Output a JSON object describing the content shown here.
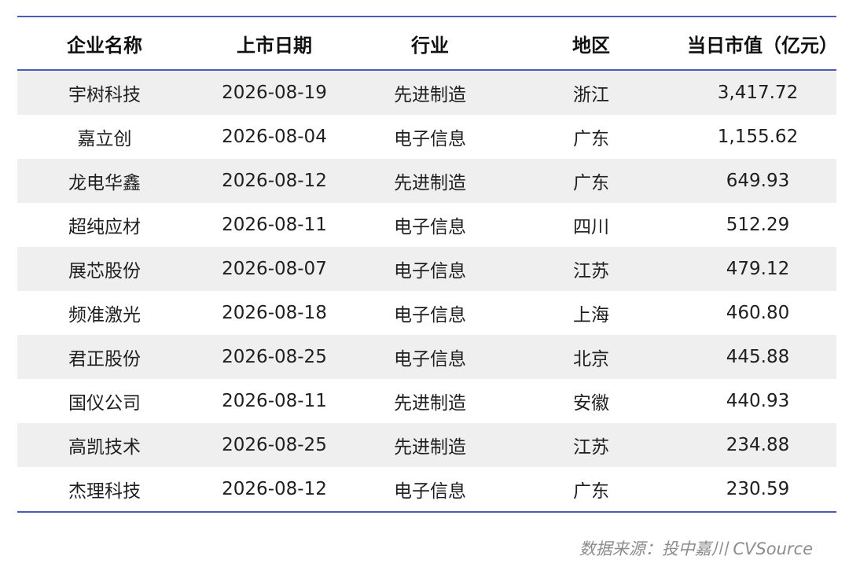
{
  "chart_data": {
    "type": "table",
    "columns": [
      "企业名称",
      "上市日期",
      "行业",
      "地区",
      "当日市值（亿元）"
    ],
    "rows": [
      [
        "宇树科技",
        "2026-08-19",
        "先进制造",
        "浙江",
        "3,417.72"
      ],
      [
        "嘉立创",
        "2026-08-04",
        "电子信息",
        "广东",
        "1,155.62"
      ],
      [
        "龙电华鑫",
        "2026-08-12",
        "先进制造",
        "广东",
        "649.93"
      ],
      [
        "超纯应材",
        "2026-08-11",
        "电子信息",
        "四川",
        "512.29"
      ],
      [
        "展芯股份",
        "2026-08-07",
        "电子信息",
        "江苏",
        "479.12"
      ],
      [
        "频准激光",
        "2026-08-18",
        "电子信息",
        "上海",
        "460.80"
      ],
      [
        "君正股份",
        "2026-08-25",
        "电子信息",
        "北京",
        "445.88"
      ],
      [
        "国仪公司",
        "2026-08-11",
        "先进制造",
        "安徽",
        "440.93"
      ],
      [
        "高凯技术",
        "2026-08-25",
        "先进制造",
        "江苏",
        "234.88"
      ],
      [
        "杰理科技",
        "2026-08-12",
        "电子信息",
        "广东",
        "230.59"
      ]
    ],
    "source": "数据来源：投中嘉川 CVSource"
  },
  "colors": {
    "rule": "#4a5bb8",
    "row_shade": "#efefef",
    "source_text": "#8c8c8c"
  }
}
